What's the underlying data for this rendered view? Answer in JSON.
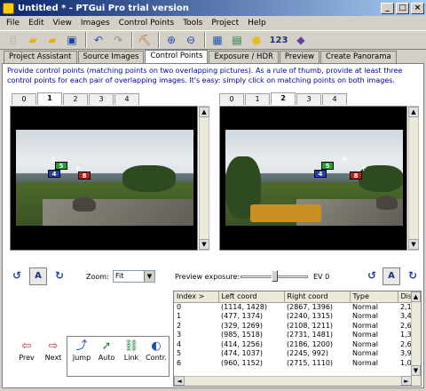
{
  "window": {
    "title": "Untitled * - PTGui Pro trial version"
  },
  "titlebar": {
    "minimize": "_",
    "maximize": "□",
    "close": "×"
  },
  "menu": [
    "File",
    "Edit",
    "View",
    "Images",
    "Control Points",
    "Tools",
    "Project",
    "Help"
  ],
  "toolbar": {
    "numbering_label": "123"
  },
  "tabs": [
    "Project Assistant",
    "Source Images",
    "Control Points",
    "Exposure / HDR",
    "Preview",
    "Create Panorama"
  ],
  "active_tab": "Control Points",
  "instructions": "Provide control points (matching points on two overlapping pictures). As a rule of thumb, provide at least three control points for each pair of overlapping images. It's easy: simply click on matching points on both images.",
  "left_image_tabs": [
    "0",
    "1",
    "2",
    "3",
    "4"
  ],
  "left_active": "1",
  "right_image_tabs": [
    "0",
    "1",
    "2",
    "3",
    "4"
  ],
  "right_active": "2",
  "scroll": {
    "up": "▲",
    "down": "▼",
    "left": "◄",
    "right": "►"
  },
  "left_markers": [
    "5",
    "4",
    "8"
  ],
  "right_markers": [
    "5",
    "4",
    "8"
  ],
  "controls": {
    "auto_label": "A",
    "zoom_label": "Zoom:",
    "zoom_value": "Fit",
    "preview_exposure_label": "Preview exposure:",
    "ev_label": "EV 0"
  },
  "table": {
    "columns": [
      "Index >",
      "Left coord",
      "Right coord",
      "Type",
      "Dist"
    ],
    "rows": [
      [
        "0",
        "(1114, 1428)",
        "(2867, 1396)",
        "Normal",
        "2,1"
      ],
      [
        "1",
        "(477, 1374)",
        "(2240, 1315)",
        "Normal",
        "3,4"
      ],
      [
        "2",
        "(329, 1269)",
        "(2108, 1211)",
        "Normal",
        "2,6"
      ],
      [
        "3",
        "(985, 1518)",
        "(2731, 1481)",
        "Normal",
        "1,3"
      ],
      [
        "4",
        "(414, 1256)",
        "(2186, 1200)",
        "Normal",
        "2,6"
      ],
      [
        "5",
        "(474, 1037)",
        "(2245, 992)",
        "Normal",
        "3,9"
      ],
      [
        "6",
        "(960, 1152)",
        "(2715, 1110)",
        "Normal",
        "1,0"
      ]
    ]
  },
  "nav": {
    "prev": "Prev",
    "next": "Next",
    "jump": "Jump",
    "auto": "Auto",
    "link": "Link",
    "contr": "Contr."
  }
}
